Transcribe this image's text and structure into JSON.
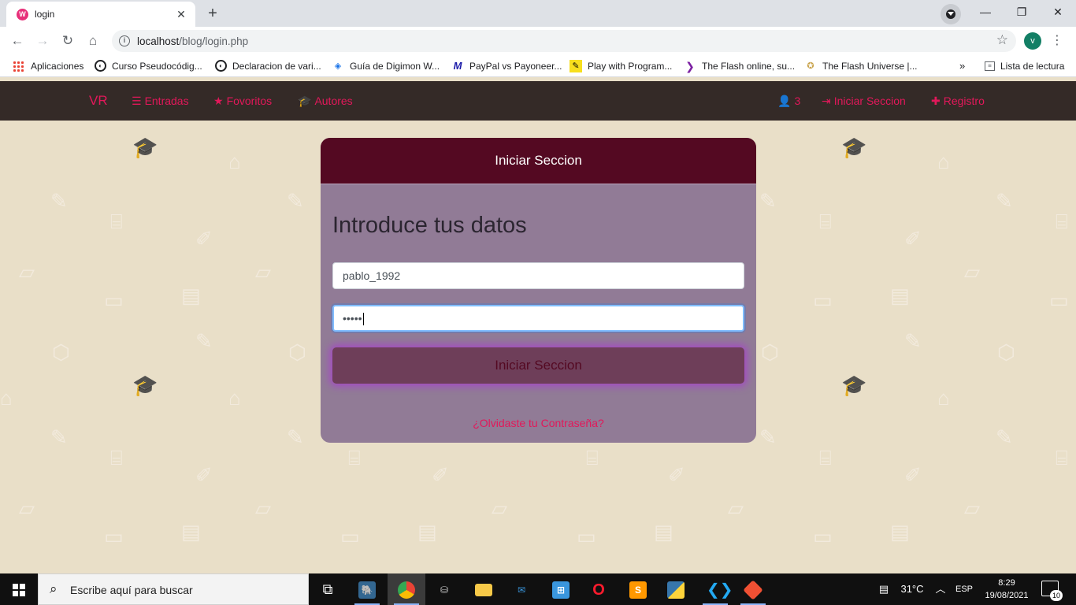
{
  "browser": {
    "tab": {
      "title": "login",
      "close_glyph": "✕",
      "favicon": "W"
    },
    "new_tab_glyph": "+",
    "window_controls": {
      "minimize": "—",
      "maximize": "❐",
      "close": "✕"
    },
    "toolbar": {
      "back": "←",
      "forward": "→",
      "reload": "↻",
      "home": "⌂",
      "url_host": "localhost",
      "url_path": "/blog/login.php",
      "bookmark_star": "☆",
      "profile_initial": "v",
      "menu": "⋮"
    },
    "bookmarks": [
      {
        "label": "Aplicaciones",
        "icon": "apps-grid-icon"
      },
      {
        "label": "Curso Pseudocódig...",
        "icon": "github-icon"
      },
      {
        "label": "Declaracion de vari...",
        "icon": "github-icon"
      },
      {
        "label": "Guía de Digimon W...",
        "icon": "digimon-icon"
      },
      {
        "label": "PayPal vs Payoneer...",
        "icon": "m-icon"
      },
      {
        "label": "Play with Program...",
        "icon": "pencil-icon"
      },
      {
        "label": "The Flash online, su...",
        "icon": "play-icon"
      },
      {
        "label": "The Flash Universe |...",
        "icon": "compass-icon"
      }
    ],
    "bookmarks_overflow": "»",
    "reading_list": "Lista de lectura"
  },
  "site_nav": {
    "brand": "VR",
    "left_links": [
      {
        "label": "Entradas",
        "icon": "list-icon"
      },
      {
        "label": "Fovoritos",
        "icon": "star-icon"
      },
      {
        "label": "Autores",
        "icon": "graduation-cap-icon"
      }
    ],
    "user_count": "3",
    "login_link": "Iniciar Seccion",
    "register_link": "Registro"
  },
  "login": {
    "header": "Iniciar Seccion",
    "heading": "Introduce tus datos",
    "username_value": "pablo_1992",
    "password_mask": "•••••",
    "submit_label": "Iniciar Seccion",
    "forgot_link": "¿Olvidaste tu Contraseña?"
  },
  "taskbar": {
    "search_placeholder": "Escribe aquí para buscar",
    "weather": "31°C",
    "language": "ESP",
    "time": "8:29",
    "date": "19/08/2021",
    "notification_count": "10"
  },
  "colors": {
    "accent": "#e2185a",
    "card_header": "#540922",
    "card_body": "#917b96",
    "nav_bg": "#342a27",
    "page_bg": "#e9dfc8"
  }
}
